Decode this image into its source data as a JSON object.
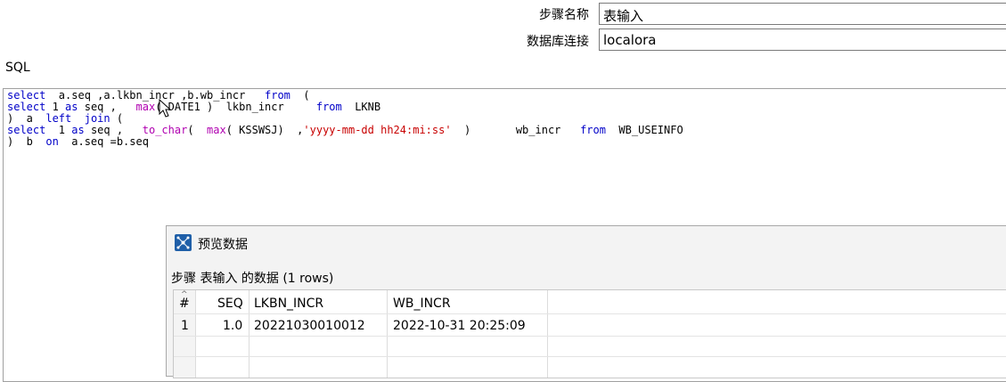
{
  "form": {
    "step_name_label": "步骤名称",
    "step_name_value": "表输入",
    "connection_label": "数据库连接",
    "connection_value": "localora"
  },
  "sql": {
    "title": "SQL",
    "lines": [
      [
        [
          "kw",
          "select"
        ],
        [
          "t",
          "  a.seq ,a.lkbn_incr ,b.wb_incr   "
        ],
        [
          "kw",
          "from"
        ],
        [
          "t",
          "  ("
        ]
      ],
      [
        [
          "kw",
          "select"
        ],
        [
          "t",
          " 1 "
        ],
        [
          "kw",
          "as"
        ],
        [
          "t",
          " seq ,   "
        ],
        [
          "fn",
          "max"
        ],
        [
          "t",
          "( DATE1 )  lkbn_incr     "
        ],
        [
          "kw",
          "from"
        ],
        [
          "t",
          "  LKNB"
        ]
      ],
      [
        [
          "t",
          ")  a  "
        ],
        [
          "kw",
          "left"
        ],
        [
          "t",
          "  "
        ],
        [
          "kw",
          "join"
        ],
        [
          "t",
          " ("
        ]
      ],
      [
        [
          "kw",
          "select"
        ],
        [
          "t",
          "  1 "
        ],
        [
          "kw",
          "as"
        ],
        [
          "t",
          " seq ,   "
        ],
        [
          "fn",
          "to_char"
        ],
        [
          "t",
          "(  "
        ],
        [
          "fn",
          "max"
        ],
        [
          "t",
          "( KSSWSJ)  ,"
        ],
        [
          "str",
          "'yyyy-mm-dd hh24:mi:ss'"
        ],
        [
          "t",
          "  )       wb_incr   "
        ],
        [
          "kw",
          "from"
        ],
        [
          "t",
          "  WB_USEINFO"
        ]
      ],
      [
        [
          "t",
          ")  b  "
        ],
        [
          "kw",
          "on"
        ],
        [
          "t",
          "  a.seq =b.seq"
        ]
      ]
    ]
  },
  "preview": {
    "title": "预览数据",
    "subtitle": "步骤 表输入 的数据 (1 rows)",
    "columns": [
      "#",
      "SEQ",
      "LKBN_INCR",
      "WB_INCR"
    ],
    "rows": [
      [
        "1",
        "1.0",
        "20221030010012",
        "2022-10-31 20:25:09"
      ]
    ]
  }
}
